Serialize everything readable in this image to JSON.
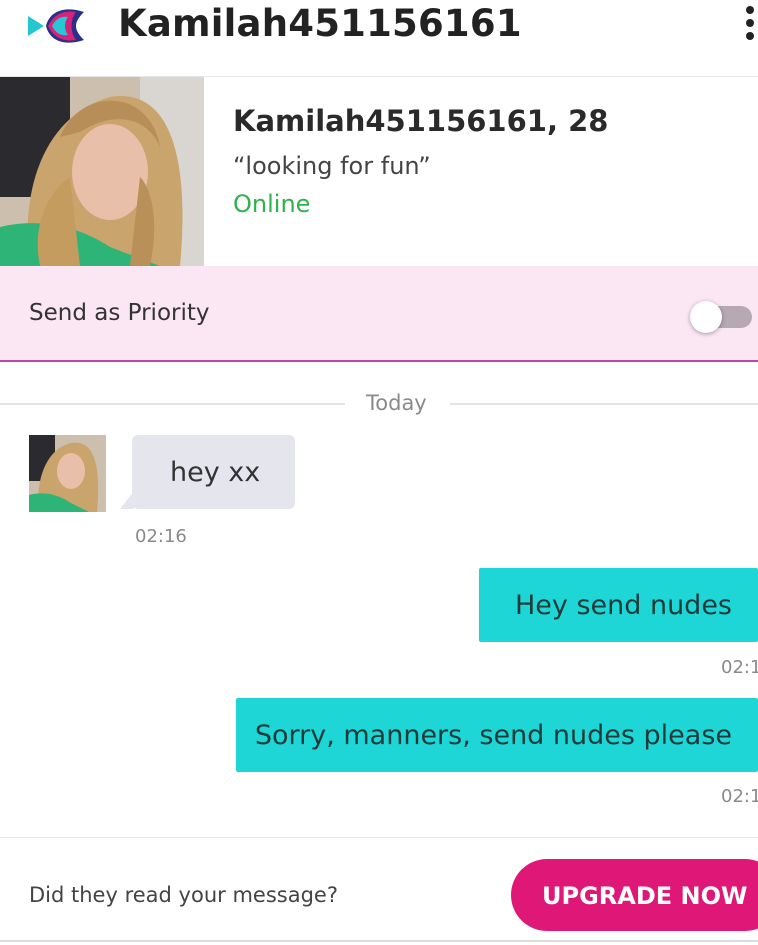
{
  "header": {
    "title": "Kamilah451156161",
    "logo_icon": "fish-logo-icon",
    "menu_icon": "kebab-menu-icon"
  },
  "profile": {
    "name_age": "Kamilah451156161, 28",
    "tagline": "“looking for fun”",
    "status": "Online",
    "status_color": "#2fb24f"
  },
  "priority": {
    "label": "Send as Priority",
    "toggle_on": false,
    "background": "#fbe6f3"
  },
  "chat": {
    "date_divider": "Today",
    "messages": [
      {
        "direction": "in",
        "text": "hey xx",
        "time": "02:16"
      },
      {
        "direction": "out",
        "text": "Hey send nudes",
        "time": "02:1"
      },
      {
        "direction": "out",
        "text": "Sorry, manners, send nudes please",
        "time": "02:1"
      }
    ],
    "outgoing_color": "#1fd6d6",
    "incoming_color": "#e5e6ed"
  },
  "footer": {
    "prompt": "Did they read your message?",
    "button_label": "UPGRADE NOW",
    "button_color": "#df1877"
  }
}
